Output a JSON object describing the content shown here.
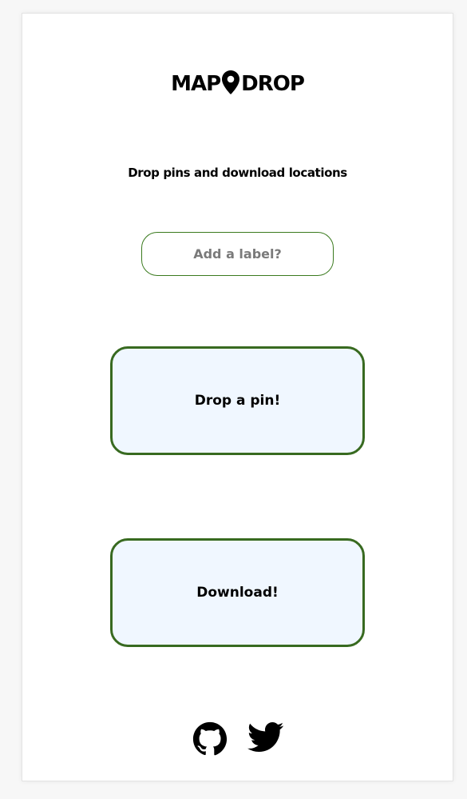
{
  "app": {
    "title_left": "MAP",
    "title_right": "DROP",
    "subtitle": "Drop pins and download locations"
  },
  "label_input": {
    "placeholder": "Add a label?"
  },
  "buttons": {
    "drop_pin": "Drop a pin!",
    "download": "Download!"
  },
  "social": {
    "icons": [
      "github-icon",
      "twitter-icon"
    ]
  },
  "colors": {
    "accent_border": "#386a20",
    "button_bg": "#f0f7ff"
  }
}
